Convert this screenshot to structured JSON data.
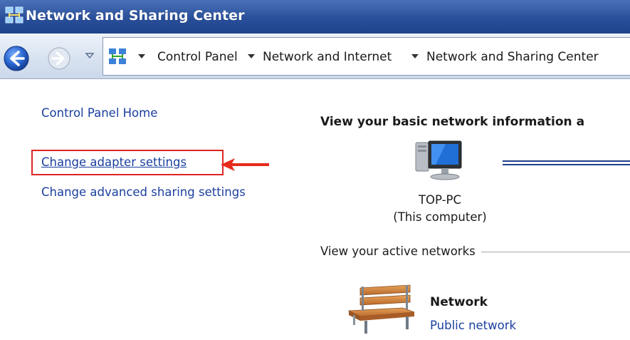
{
  "window": {
    "title": "Network and Sharing Center",
    "icon": "network-center-icon"
  },
  "address_bar": {
    "crumbs": [
      "Control Panel",
      "Network and Internet",
      "Network and Sharing Center"
    ],
    "back_icon": "back-arrow-icon",
    "forward_icon": "forward-arrow-icon"
  },
  "left_pane": {
    "links": [
      "Control Panel Home",
      "Change adapter settings",
      "Change advanced sharing settings"
    ],
    "highlighted_index": 1
  },
  "main": {
    "heading": "View your basic network information a",
    "computer": {
      "name": "TOP-PC",
      "subtitle": "(This computer)",
      "icon": "computer-icon"
    },
    "active_networks_label": "View your active networks",
    "network": {
      "name": "Network",
      "type": "Public network",
      "icon": "bench-icon"
    }
  },
  "colors": {
    "title_bar": "#2a4f9a",
    "link": "#1a3f9e",
    "highlight": "#e02424"
  }
}
